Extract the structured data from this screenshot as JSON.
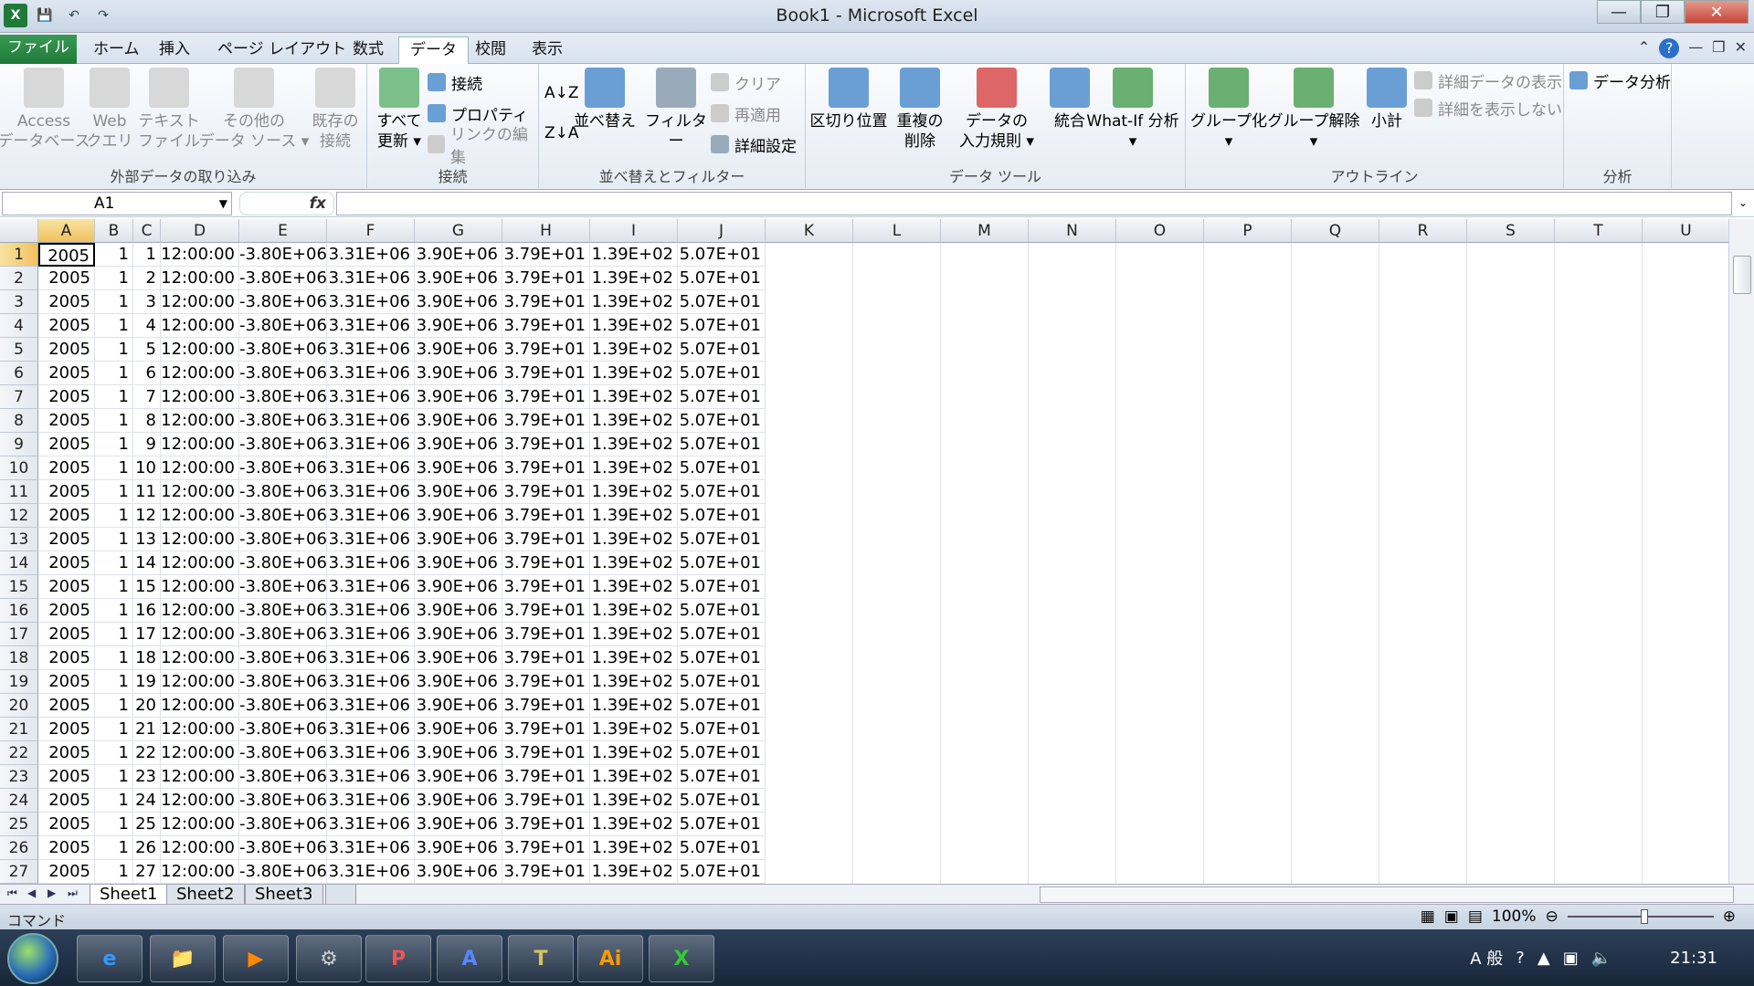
{
  "window": {
    "title": "Book1 - Microsoft Excel",
    "min": "—",
    "max": "❐",
    "close": "✕"
  },
  "tabs": [
    {
      "label": "ファイル"
    },
    {
      "label": "ホーム"
    },
    {
      "label": "挿入"
    },
    {
      "label": "ページ レイアウト"
    },
    {
      "label": "数式"
    },
    {
      "label": "データ"
    },
    {
      "label": "校閲"
    },
    {
      "label": "表示"
    }
  ],
  "ribbon": {
    "ext": {
      "label": "外部データの取り込み",
      "access": "Access\nデータベース",
      "web": "Web\nクエリ",
      "text": "テキスト\nファイル",
      "other": "その他の\nデータ ソース ▾",
      "existing": "既存の\n接続"
    },
    "conn": {
      "label": "接続",
      "refresh": "すべて\n更新 ▾",
      "connections": "接続",
      "properties": "プロパティ",
      "editlinks": "リンクの編集"
    },
    "sort": {
      "label": "並べ替えとフィルター",
      "sort": "並べ替え",
      "filter": "フィルター",
      "clear": "クリア",
      "reapply": "再適用",
      "advanced": "詳細設定"
    },
    "tools": {
      "label": "データ ツール",
      "text_to_col": "区切り位置",
      "remove_dup": "重複の\n削除",
      "validation": "データの\n入力規則 ▾",
      "consolidate": "統合",
      "whatif": "What-If 分析\n▾"
    },
    "outline": {
      "label": "アウトライン",
      "group": "グループ化\n▾",
      "ungroup": "グループ解除\n▾",
      "subtotal": "小計",
      "show": "詳細データの表示",
      "hide": "詳細を表示しない"
    },
    "analysis": {
      "label": "分析",
      "data_analysis": "データ分析"
    }
  },
  "formula_bar": {
    "name_box": "A1",
    "fx": "fx",
    "value": ""
  },
  "columns": [
    "A",
    "B",
    "C",
    "D",
    "E",
    "F",
    "G",
    "H",
    "I",
    "J",
    "K",
    "L",
    "M",
    "N",
    "O",
    "P",
    "Q",
    "R",
    "S",
    "T",
    "U"
  ],
  "rows": [
    [
      "2005",
      "1",
      "1",
      "12:00:00",
      "-3.80E+06",
      "3.31E+06",
      "3.90E+06",
      "3.79E+01",
      "1.39E+02",
      "5.07E+01"
    ],
    [
      "2005",
      "1",
      "2",
      "12:00:00",
      "-3.80E+06",
      "3.31E+06",
      "3.90E+06",
      "3.79E+01",
      "1.39E+02",
      "5.07E+01"
    ],
    [
      "2005",
      "1",
      "3",
      "12:00:00",
      "-3.80E+06",
      "3.31E+06",
      "3.90E+06",
      "3.79E+01",
      "1.39E+02",
      "5.07E+01"
    ],
    [
      "2005",
      "1",
      "4",
      "12:00:00",
      "-3.80E+06",
      "3.31E+06",
      "3.90E+06",
      "3.79E+01",
      "1.39E+02",
      "5.07E+01"
    ],
    [
      "2005",
      "1",
      "5",
      "12:00:00",
      "-3.80E+06",
      "3.31E+06",
      "3.90E+06",
      "3.79E+01",
      "1.39E+02",
      "5.07E+01"
    ],
    [
      "2005",
      "1",
      "6",
      "12:00:00",
      "-3.80E+06",
      "3.31E+06",
      "3.90E+06",
      "3.79E+01",
      "1.39E+02",
      "5.07E+01"
    ],
    [
      "2005",
      "1",
      "7",
      "12:00:00",
      "-3.80E+06",
      "3.31E+06",
      "3.90E+06",
      "3.79E+01",
      "1.39E+02",
      "5.07E+01"
    ],
    [
      "2005",
      "1",
      "8",
      "12:00:00",
      "-3.80E+06",
      "3.31E+06",
      "3.90E+06",
      "3.79E+01",
      "1.39E+02",
      "5.07E+01"
    ],
    [
      "2005",
      "1",
      "9",
      "12:00:00",
      "-3.80E+06",
      "3.31E+06",
      "3.90E+06",
      "3.79E+01",
      "1.39E+02",
      "5.07E+01"
    ],
    [
      "2005",
      "1",
      "10",
      "12:00:00",
      "-3.80E+06",
      "3.31E+06",
      "3.90E+06",
      "3.79E+01",
      "1.39E+02",
      "5.07E+01"
    ],
    [
      "2005",
      "1",
      "11",
      "12:00:00",
      "-3.80E+06",
      "3.31E+06",
      "3.90E+06",
      "3.79E+01",
      "1.39E+02",
      "5.07E+01"
    ],
    [
      "2005",
      "1",
      "12",
      "12:00:00",
      "-3.80E+06",
      "3.31E+06",
      "3.90E+06",
      "3.79E+01",
      "1.39E+02",
      "5.07E+01"
    ],
    [
      "2005",
      "1",
      "13",
      "12:00:00",
      "-3.80E+06",
      "3.31E+06",
      "3.90E+06",
      "3.79E+01",
      "1.39E+02",
      "5.07E+01"
    ],
    [
      "2005",
      "1",
      "14",
      "12:00:00",
      "-3.80E+06",
      "3.31E+06",
      "3.90E+06",
      "3.79E+01",
      "1.39E+02",
      "5.07E+01"
    ],
    [
      "2005",
      "1",
      "15",
      "12:00:00",
      "-3.80E+06",
      "3.31E+06",
      "3.90E+06",
      "3.79E+01",
      "1.39E+02",
      "5.07E+01"
    ],
    [
      "2005",
      "1",
      "16",
      "12:00:00",
      "-3.80E+06",
      "3.31E+06",
      "3.90E+06",
      "3.79E+01",
      "1.39E+02",
      "5.07E+01"
    ],
    [
      "2005",
      "1",
      "17",
      "12:00:00",
      "-3.80E+06",
      "3.31E+06",
      "3.90E+06",
      "3.79E+01",
      "1.39E+02",
      "5.07E+01"
    ],
    [
      "2005",
      "1",
      "18",
      "12:00:00",
      "-3.80E+06",
      "3.31E+06",
      "3.90E+06",
      "3.79E+01",
      "1.39E+02",
      "5.07E+01"
    ],
    [
      "2005",
      "1",
      "19",
      "12:00:00",
      "-3.80E+06",
      "3.31E+06",
      "3.90E+06",
      "3.79E+01",
      "1.39E+02",
      "5.07E+01"
    ],
    [
      "2005",
      "1",
      "20",
      "12:00:00",
      "-3.80E+06",
      "3.31E+06",
      "3.90E+06",
      "3.79E+01",
      "1.39E+02",
      "5.07E+01"
    ],
    [
      "2005",
      "1",
      "21",
      "12:00:00",
      "-3.80E+06",
      "3.31E+06",
      "3.90E+06",
      "3.79E+01",
      "1.39E+02",
      "5.07E+01"
    ],
    [
      "2005",
      "1",
      "22",
      "12:00:00",
      "-3.80E+06",
      "3.31E+06",
      "3.90E+06",
      "3.79E+01",
      "1.39E+02",
      "5.07E+01"
    ],
    [
      "2005",
      "1",
      "23",
      "12:00:00",
      "-3.80E+06",
      "3.31E+06",
      "3.90E+06",
      "3.79E+01",
      "1.39E+02",
      "5.07E+01"
    ],
    [
      "2005",
      "1",
      "24",
      "12:00:00",
      "-3.80E+06",
      "3.31E+06",
      "3.90E+06",
      "3.79E+01",
      "1.39E+02",
      "5.07E+01"
    ],
    [
      "2005",
      "1",
      "25",
      "12:00:00",
      "-3.80E+06",
      "3.31E+06",
      "3.90E+06",
      "3.79E+01",
      "1.39E+02",
      "5.07E+01"
    ],
    [
      "2005",
      "1",
      "26",
      "12:00:00",
      "-3.80E+06",
      "3.31E+06",
      "3.90E+06",
      "3.79E+01",
      "1.39E+02",
      "5.07E+01"
    ],
    [
      "2005",
      "1",
      "27",
      "12:00:00",
      "-3.80E+06",
      "3.31E+06",
      "3.90E+06",
      "3.79E+01",
      "1.39E+02",
      "5.07E+01"
    ]
  ],
  "sheets": [
    "Sheet1",
    "Sheet2",
    "Sheet3"
  ],
  "status": {
    "mode": "コマンド",
    "zoom": "100%"
  },
  "taskbar": {
    "ime": "A 般",
    "clock": "21:31",
    "apps": [
      "ie-icon",
      "explorer-icon",
      "media-icon",
      "tool-icon",
      "powerpoint-icon",
      "wordpad-icon",
      "notebook-icon",
      "illustrator-icon",
      "excel-icon"
    ]
  },
  "colors": {
    "accent": "#1f7a38",
    "selected_header": "#f1c15f"
  }
}
